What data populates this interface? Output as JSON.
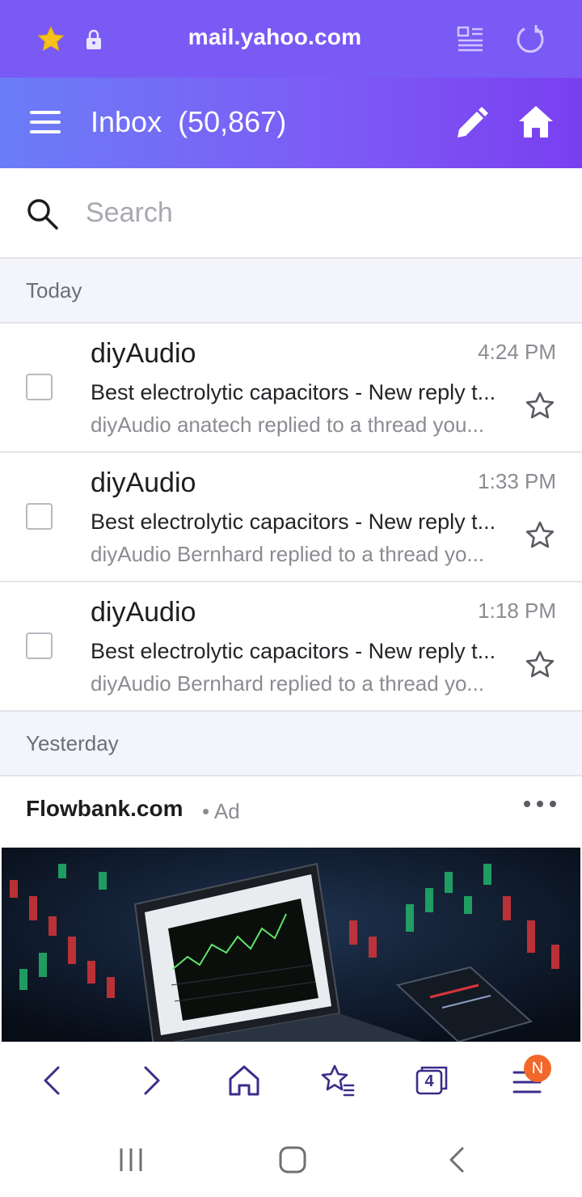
{
  "browser": {
    "url": "mail.yahoo.com",
    "icons": [
      "star-icon",
      "lock-icon",
      "reader-mode-icon",
      "reload-icon"
    ]
  },
  "header": {
    "inbox_label": "Inbox",
    "unread_count": "(50,867)",
    "icons": [
      "menu-icon",
      "compose-icon",
      "home-icon"
    ]
  },
  "search": {
    "placeholder": "Search"
  },
  "sections": {
    "today": "Today",
    "yesterday": "Yesterday"
  },
  "messages": [
    {
      "sender": "diyAudio",
      "time": "4:24 PM",
      "subject": "Best electrolytic capacitors - New reply t...",
      "preview": "diyAudio anatech replied to a thread you..."
    },
    {
      "sender": "diyAudio",
      "time": "1:33 PM",
      "subject": "Best electrolytic capacitors - New reply t...",
      "preview": "diyAudio Bernhard replied to a thread yo..."
    },
    {
      "sender": "diyAudio",
      "time": "1:18 PM",
      "subject": "Best electrolytic capacitors - New reply t...",
      "preview": "diyAudio Bernhard replied to a thread yo..."
    }
  ],
  "ad": {
    "brand": "Flowbank.com",
    "tag": "• Ad"
  },
  "bottom_nav": {
    "tab_count": "4",
    "menu_badge": "N",
    "icons": [
      "back-icon",
      "forward-icon",
      "home-icon",
      "bookmarks-icon",
      "tabs-icon",
      "menu-icon"
    ]
  },
  "colors": {
    "url_bar": "#7a5af5",
    "header_gradient_start": "#6b7df7",
    "header_gradient_end": "#7a3ff0",
    "nav_icon": "#3a2d8a",
    "badge": "#f2672a"
  }
}
